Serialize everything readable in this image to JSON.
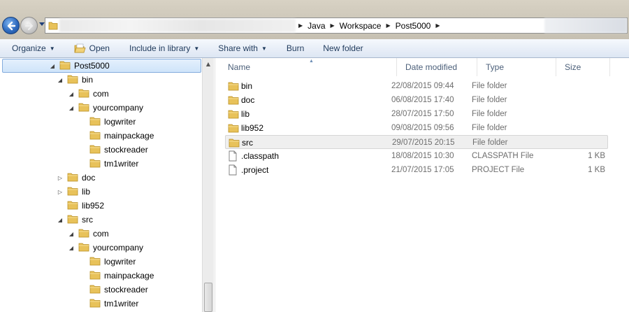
{
  "address_bar": {
    "breadcrumbs": [
      "Java",
      "Workspace",
      "Post5000"
    ]
  },
  "toolbar": {
    "organize": "Organize",
    "open": "Open",
    "include_in_library": "Include in library",
    "share_with": "Share with",
    "burn": "Burn",
    "new_folder": "New folder"
  },
  "tree": {
    "items": [
      {
        "label": "Post5000",
        "expander": "expanded"
      },
      {
        "label": "bin",
        "expander": "expanded"
      },
      {
        "label": "com",
        "expander": "expanded"
      },
      {
        "label": "yourcompany",
        "expander": "expanded"
      },
      {
        "label": "logwriter",
        "expander": "none"
      },
      {
        "label": "mainpackage",
        "expander": "none"
      },
      {
        "label": "stockreader",
        "expander": "none"
      },
      {
        "label": "tm1writer",
        "expander": "none"
      },
      {
        "label": "doc",
        "expander": "collapsed"
      },
      {
        "label": "lib",
        "expander": "collapsed"
      },
      {
        "label": "lib952",
        "expander": "none"
      },
      {
        "label": "src",
        "expander": "expanded"
      },
      {
        "label": "com",
        "expander": "expanded"
      },
      {
        "label": "yourcompany",
        "expander": "expanded"
      },
      {
        "label": "logwriter",
        "expander": "none"
      },
      {
        "label": "mainpackage",
        "expander": "none"
      },
      {
        "label": "stockreader",
        "expander": "none"
      },
      {
        "label": "tm1writer",
        "expander": "none"
      }
    ]
  },
  "file_list": {
    "columns": {
      "name": "Name",
      "date": "Date modified",
      "type": "Type",
      "size": "Size"
    },
    "rows": [
      {
        "name": "bin",
        "date": "22/08/2015 09:44",
        "type": "File folder",
        "size": "",
        "icon": "folder-icon"
      },
      {
        "name": "doc",
        "date": "06/08/2015 17:40",
        "type": "File folder",
        "size": "",
        "icon": "folder-icon"
      },
      {
        "name": "lib",
        "date": "28/07/2015 17:50",
        "type": "File folder",
        "size": "",
        "icon": "folder-icon"
      },
      {
        "name": "lib952",
        "date": "09/08/2015 09:56",
        "type": "File folder",
        "size": "",
        "icon": "folder-icon"
      },
      {
        "name": "src",
        "date": "29/07/2015 20:15",
        "type": "File folder",
        "size": "",
        "icon": "folder-icon"
      },
      {
        "name": ".classpath",
        "date": "18/08/2015 10:30",
        "type": "CLASSPATH File",
        "size": "1 KB",
        "icon": "file-icon"
      },
      {
        "name": ".project",
        "date": "21/07/2015 17:05",
        "type": "PROJECT File",
        "size": "1 KB",
        "icon": "file-icon"
      }
    ],
    "selected_name": "src"
  },
  "colors": {
    "folder_yellow": "#e8c25a",
    "toolbar_text": "#1e395b",
    "header_text": "#4c607a",
    "selection_blue": "#cfe4fa"
  }
}
